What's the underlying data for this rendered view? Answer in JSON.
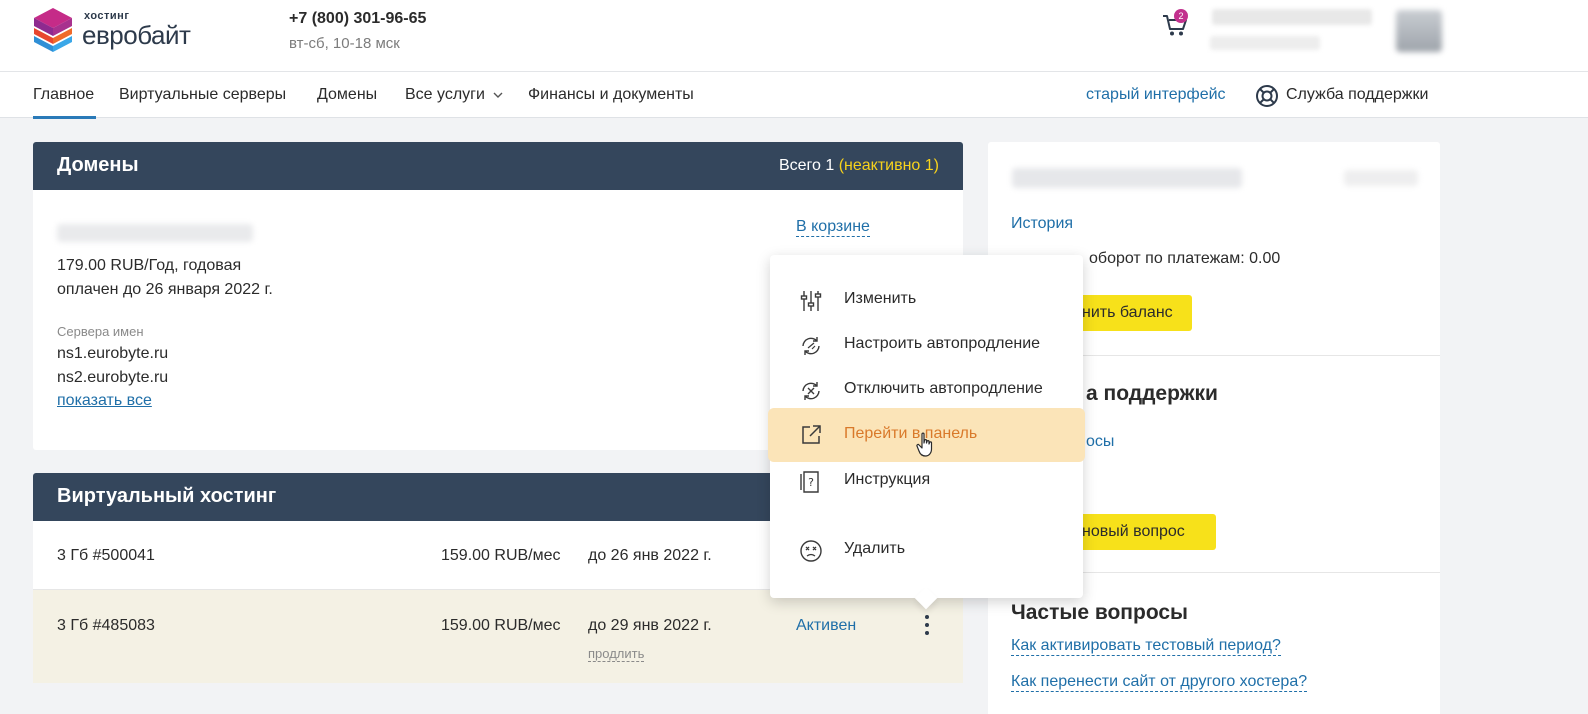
{
  "header": {
    "logo_top": "хостинг",
    "logo_main": "евробайт",
    "phone": "+7 (800) 301-96-65",
    "hours": "вт-сб, 10-18 мск",
    "cart_count": "2"
  },
  "nav": {
    "items": [
      {
        "label": "Главное"
      },
      {
        "label": "Виртуальные серверы"
      },
      {
        "label": "Домены"
      },
      {
        "label": "Все услуги"
      },
      {
        "label": "Финансы и документы"
      }
    ],
    "old_interface": "старый интерфейс",
    "support": "Служба поддержки"
  },
  "domains_card": {
    "title": "Домены",
    "total_label": "Всего 1",
    "inactive_label": "(неактивно 1)",
    "status_link": "В корзине",
    "price": "179.00 RUB/Год, годовая",
    "paid_until": "оплачен до 26 января 2022 г.",
    "ns_label": "Сервера имен",
    "ns1": "ns1.eurobyte.ru",
    "ns2": "ns2.eurobyte.ru",
    "show_all": "показать все"
  },
  "hosting_card": {
    "title": "Виртуальный хостинг",
    "rows": [
      {
        "plan": "3 Гб #500041",
        "price": "159.00 RUB/мес",
        "until": "до 26 янв 2022 г.",
        "status": "",
        "extend": ""
      },
      {
        "plan": "3 Гб #485083",
        "price": "159.00 RUB/мес",
        "until": "до 29 янв 2022 г.",
        "status": "Активен",
        "extend": "продлить"
      }
    ]
  },
  "right_panel": {
    "history": "История",
    "turnover": "оборот по платежам: 0.00",
    "topup_btn": "нить баланс",
    "support_title": "а поддержки",
    "support_link": "осы",
    "new_question_btn": "новый вопрос",
    "faq_title": "Частые вопросы",
    "faq": [
      {
        "label": "Как активировать тестовый период?"
      },
      {
        "label": "Как перенести сайт от другого хостера?"
      }
    ]
  },
  "context_menu": {
    "items": [
      {
        "label": "Изменить",
        "icon": "sliders-icon"
      },
      {
        "label": "Настроить автопродление",
        "icon": "autorenew-icon"
      },
      {
        "label": "Отключить автопродление",
        "icon": "autorenew-off-icon"
      },
      {
        "label": "Перейти в панель",
        "icon": "external-link-icon",
        "hovered": true
      },
      {
        "label": "Инструкция",
        "icon": "manual-icon"
      },
      {
        "label": "Удалить",
        "icon": "delete-icon"
      }
    ]
  },
  "colors": {
    "header_dark": "#34465c",
    "accent_yellow": "#f7e11a",
    "link_blue": "#1f6fa8",
    "hover_bg": "#fbe4b8",
    "hover_text": "#d9792a"
  }
}
